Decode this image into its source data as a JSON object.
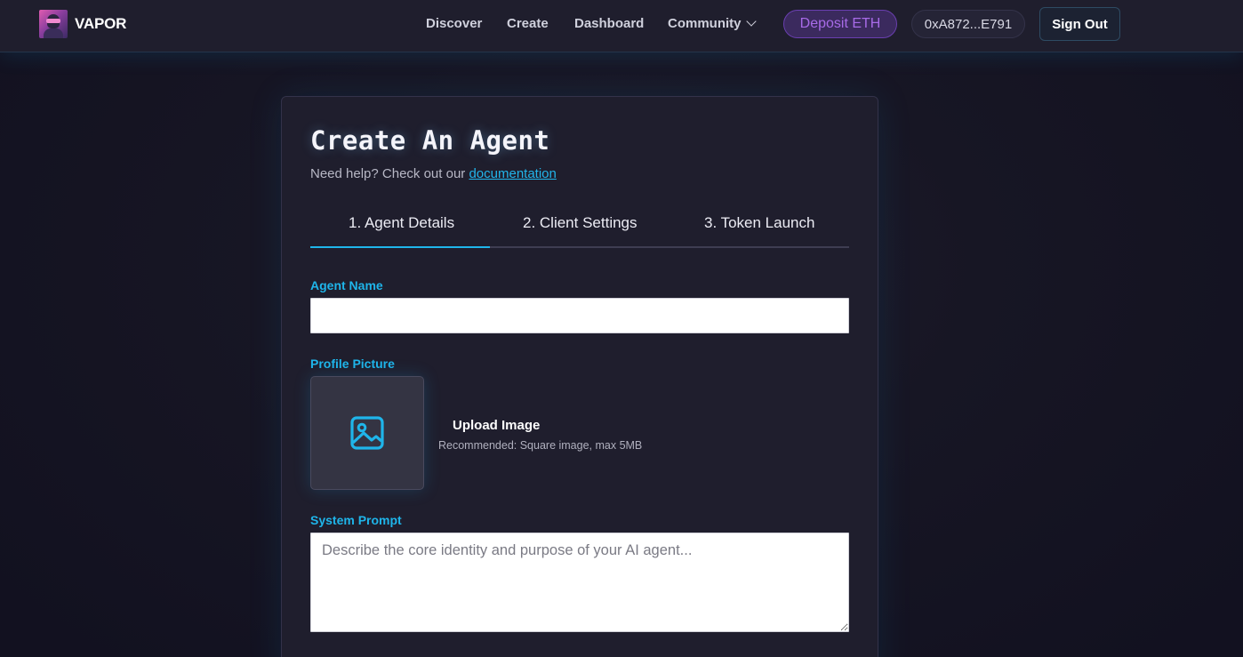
{
  "nav": {
    "brand": "VAPOR",
    "links": [
      "Discover",
      "Create",
      "Dashboard"
    ],
    "community": "Community",
    "deposit": "Deposit ETH",
    "wallet": "0xA872...E791",
    "sign_out": "Sign Out"
  },
  "colors": {
    "accent": "#1fb5ea",
    "deposit_text": "#a86be8",
    "background": "#13121f",
    "card": "#1f1e2d"
  },
  "page": {
    "title": "Create An Agent",
    "help_prefix": "Need help? Check out our",
    "help_link": "documentation"
  },
  "tabs": [
    {
      "label": "1. Agent Details",
      "active": true
    },
    {
      "label": "2. Client Settings",
      "active": false
    },
    {
      "label": "3. Token Launch",
      "active": false
    }
  ],
  "form": {
    "agent_name_label": "Agent Name",
    "agent_name_value": "",
    "profile_picture_label": "Profile Picture",
    "upload_title": "Upload Image",
    "upload_hint": "Recommended: Square image, max 5MB",
    "upload_icon": "image-icon",
    "system_prompt_label": "System Prompt",
    "system_prompt_placeholder": "Describe the core identity and purpose of your AI agent..."
  }
}
